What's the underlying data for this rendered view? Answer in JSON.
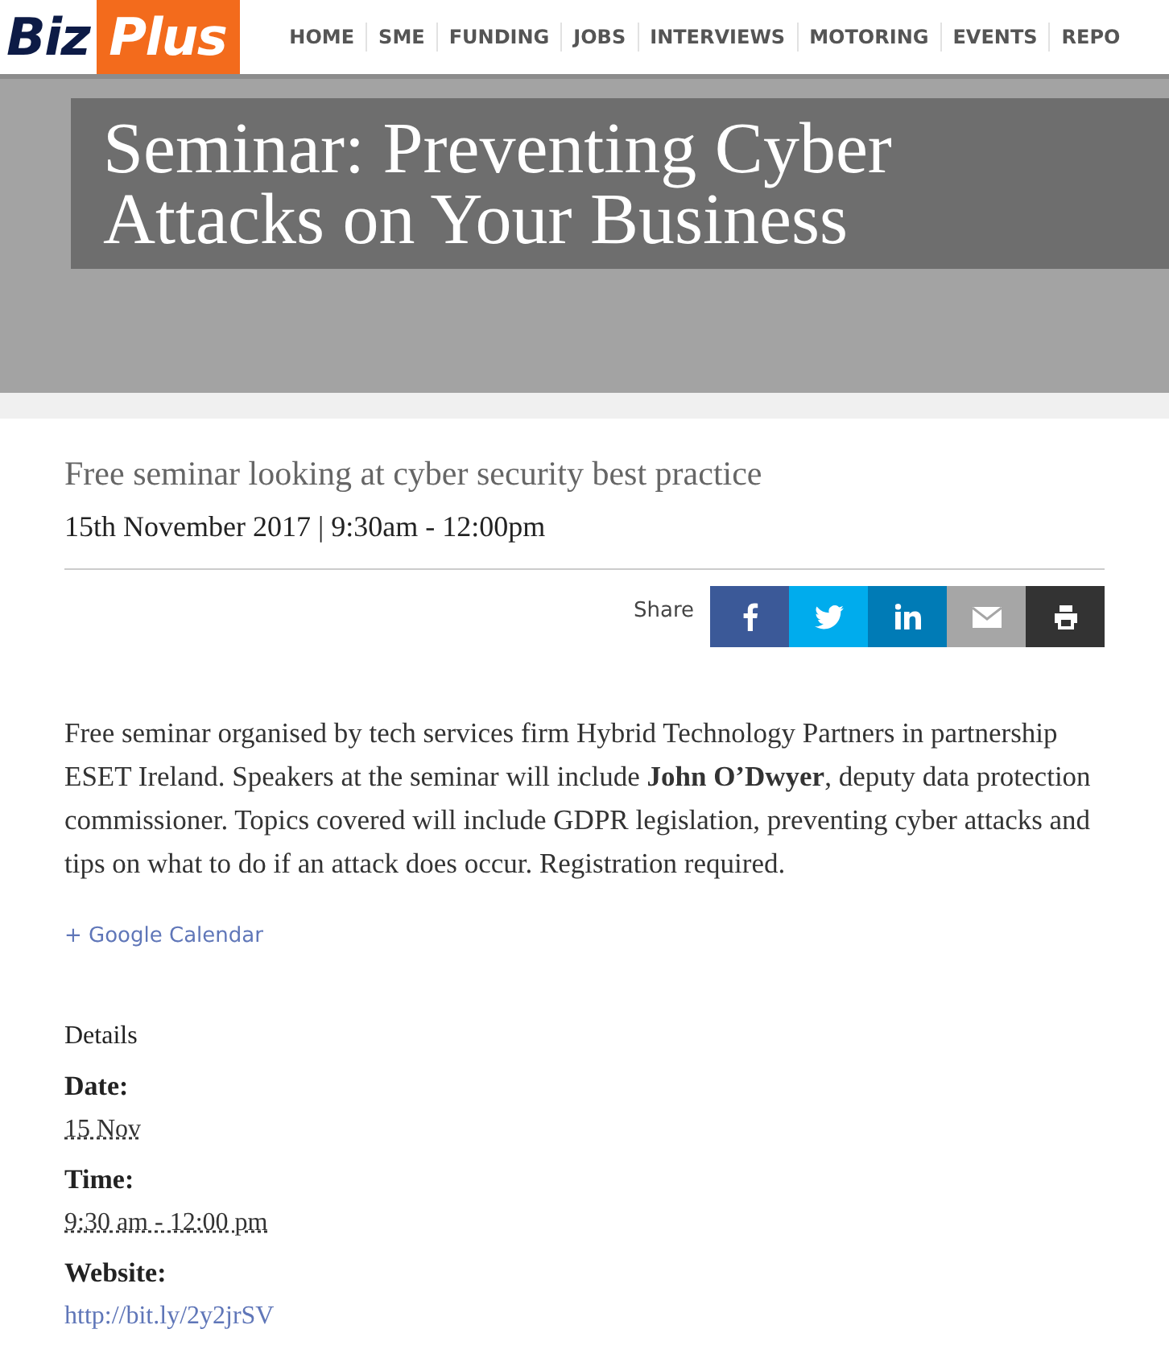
{
  "logo": {
    "part_1": "Biz",
    "part_2": "Plus"
  },
  "nav": {
    "items": [
      "HOME",
      "SME",
      "FUNDING",
      "JOBS",
      "INTERVIEWS",
      "MOTORING",
      "EVENTS",
      "REPO"
    ]
  },
  "hero": {
    "title": "Seminar: Preventing Cyber Attacks on Your Business"
  },
  "event": {
    "subtitle": "Free seminar looking at cyber security best practice",
    "when": "15th November 2017 | 9:30am - 12:00pm"
  },
  "share": {
    "label": "Share",
    "buttons": [
      {
        "kind": "facebook"
      },
      {
        "kind": "twitter"
      },
      {
        "kind": "linkedin"
      },
      {
        "kind": "email"
      },
      {
        "kind": "print"
      }
    ]
  },
  "description": "Free seminar organised by tech services firm Hybrid Technology Partners in partnership ESET Ireland. Speakers at the seminar will include **John O’Dwyer**, deputy data protection commissioner. Topics covered will include GDPR legislation, preventing cyber attacks and tips on what to do if an attack does occur. Registration required.",
  "calendar_link": "+ Google Calendar",
  "details": {
    "heading": "Details",
    "fields": [
      {
        "label": "Date:",
        "value": "15 Nov",
        "kind": "abbr"
      },
      {
        "label": "Time:",
        "value": "9:30 am - 12:00 pm",
        "kind": "abbr"
      },
      {
        "label": "Website:",
        "value": "http://bit.ly/2y2jrSV",
        "kind": "link"
      }
    ]
  }
}
